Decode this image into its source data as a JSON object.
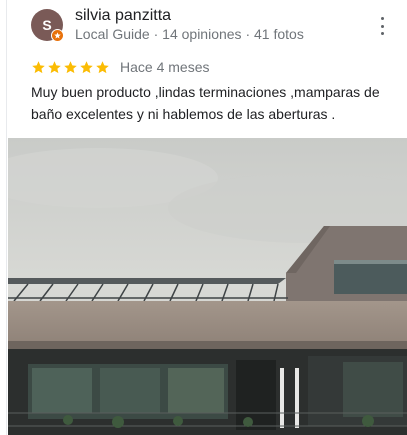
{
  "reviewer": {
    "initial": "S",
    "name": "silvia panzitta",
    "meta": "Local Guide · 14 opiniones · 41 fotos"
  },
  "review": {
    "stars": 5,
    "time": "Hace 4 meses",
    "text": "Muy buen producto ,lindas terminaciones ,mamparas de baño excelentes y ni hablemos de las aberturas ."
  },
  "colors": {
    "star": "#fbbc04",
    "avatar": "#7a5a57",
    "badge": "#e8710a",
    "secondary_text": "#70757a"
  },
  "icons": [
    "avatar",
    "local-guide-badge-icon",
    "more-vert-icon",
    "star-icon"
  ]
}
